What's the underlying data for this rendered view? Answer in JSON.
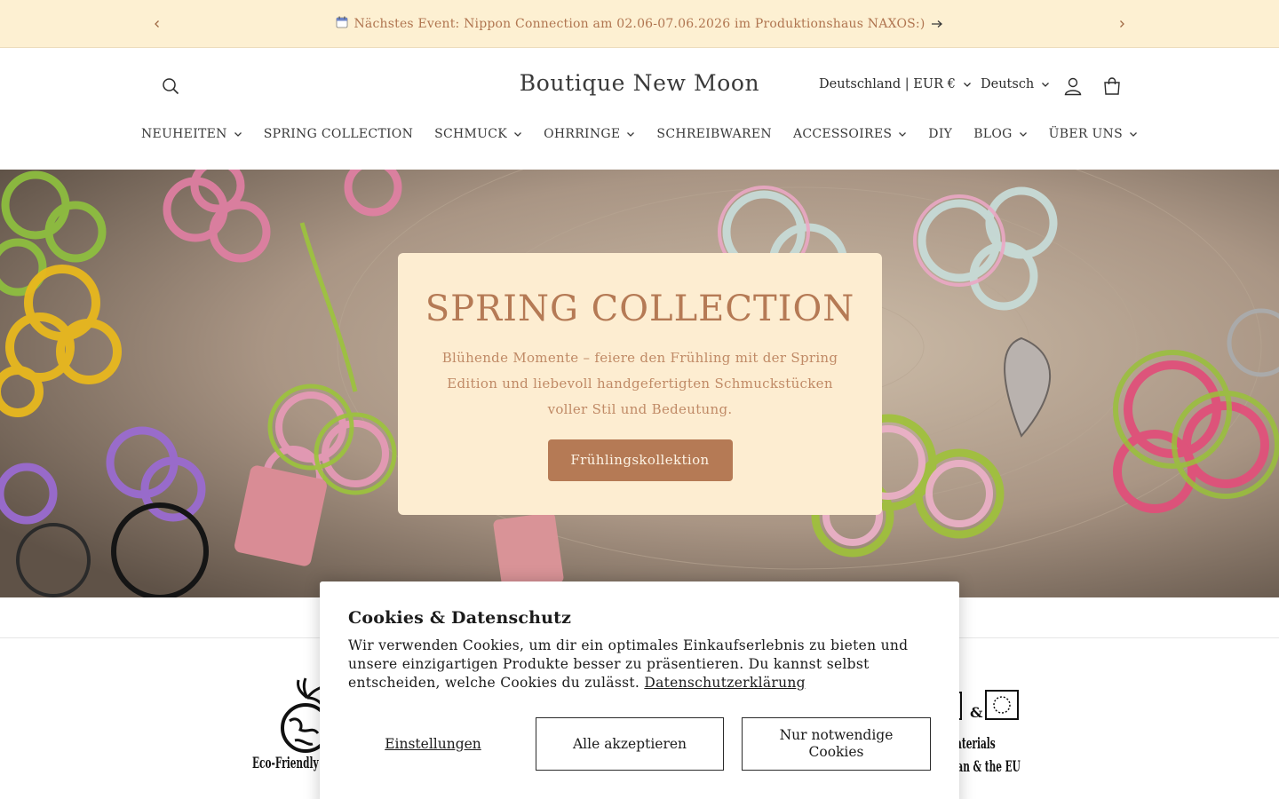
{
  "announcement": {
    "icon": "calendar-icon",
    "text": "Nächstes Event: Nippon Connection am 02.06-07.06.2026 im Produktionshaus NAXOS:)"
  },
  "header": {
    "brand": "Boutique New Moon",
    "country_selector": "Deutschland | EUR €",
    "language_selector": "Deutsch"
  },
  "nav": {
    "items": [
      {
        "label": "NEUHEITEN",
        "dropdown": true
      },
      {
        "label": "SPRING COLLECTION",
        "dropdown": false
      },
      {
        "label": "SCHMUCK",
        "dropdown": true
      },
      {
        "label": "OHRRINGE",
        "dropdown": true
      },
      {
        "label": "SCHREIBWAREN",
        "dropdown": false
      },
      {
        "label": "ACCESSOIRES",
        "dropdown": true
      },
      {
        "label": "DIY",
        "dropdown": false
      },
      {
        "label": "BLOG",
        "dropdown": true
      },
      {
        "label": "ÜBER UNS",
        "dropdown": true
      }
    ]
  },
  "hero": {
    "title": "SPRING COLLECTION",
    "text": "Blühende Momente – feiere den Frühling mit der Spring Edition und liebevoll handgefertigten Schmuckstücken voller Stil und Bedeutung.",
    "button": "Frühlingskollektion"
  },
  "features": {
    "left_caption": "Eco-Friendly P",
    "right_caption_1": "aterials",
    "right_caption_2": "pan & the EU"
  },
  "cookie": {
    "title": "Cookies & Datenschutz",
    "text": "Wir verwenden Cookies, um dir ein optimales Einkaufserlebnis zu bieten und unsere einzigartigen Produkte besser zu präsentieren. Du kannst selbst entscheiden, welche Cookies du zulässt.",
    "link": "Datenschutzerklärung",
    "settings_label": "Einstellungen",
    "accept_all_label": "Alle akzeptieren",
    "necessary_label": "Nur notwendige Cookies"
  },
  "colors": {
    "announcement_bg": "#fdf0d2",
    "accent": "#b57a55",
    "hero_card_bg": "#fdedd1"
  }
}
